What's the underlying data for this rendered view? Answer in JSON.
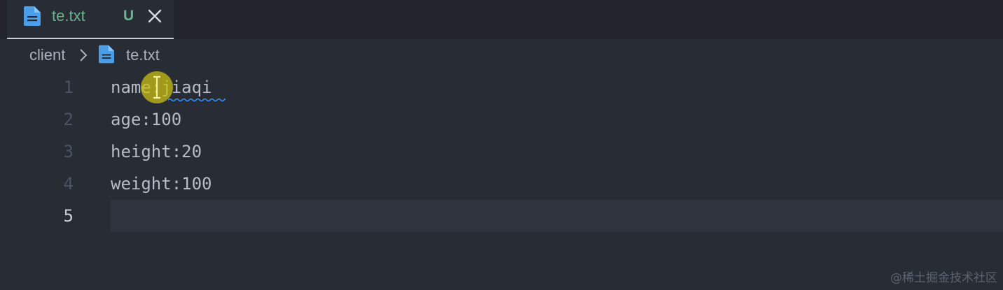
{
  "tab": {
    "label": "te.txt",
    "status": "U",
    "file_icon": "file-text-icon",
    "close_icon": "close-icon"
  },
  "breadcrumb": {
    "folder": "client",
    "file": "te.txt"
  },
  "editor": {
    "lines": [
      {
        "number": "1",
        "text": "name:jiaqi"
      },
      {
        "number": "2",
        "text": "age:100"
      },
      {
        "number": "3",
        "text": "height:20"
      },
      {
        "number": "4",
        "text": "weight:100"
      },
      {
        "number": "5",
        "text": ""
      }
    ],
    "active_line": 5
  },
  "watermark": "@稀土掘金技术社区",
  "colors": {
    "background": "#282c34",
    "tabbar": "#21252b",
    "untracked": "#6cb38f",
    "file_icon": "#4a9fe8",
    "spellcheck_underline": "#3794ff",
    "cursor_highlight": "#c8be14"
  }
}
